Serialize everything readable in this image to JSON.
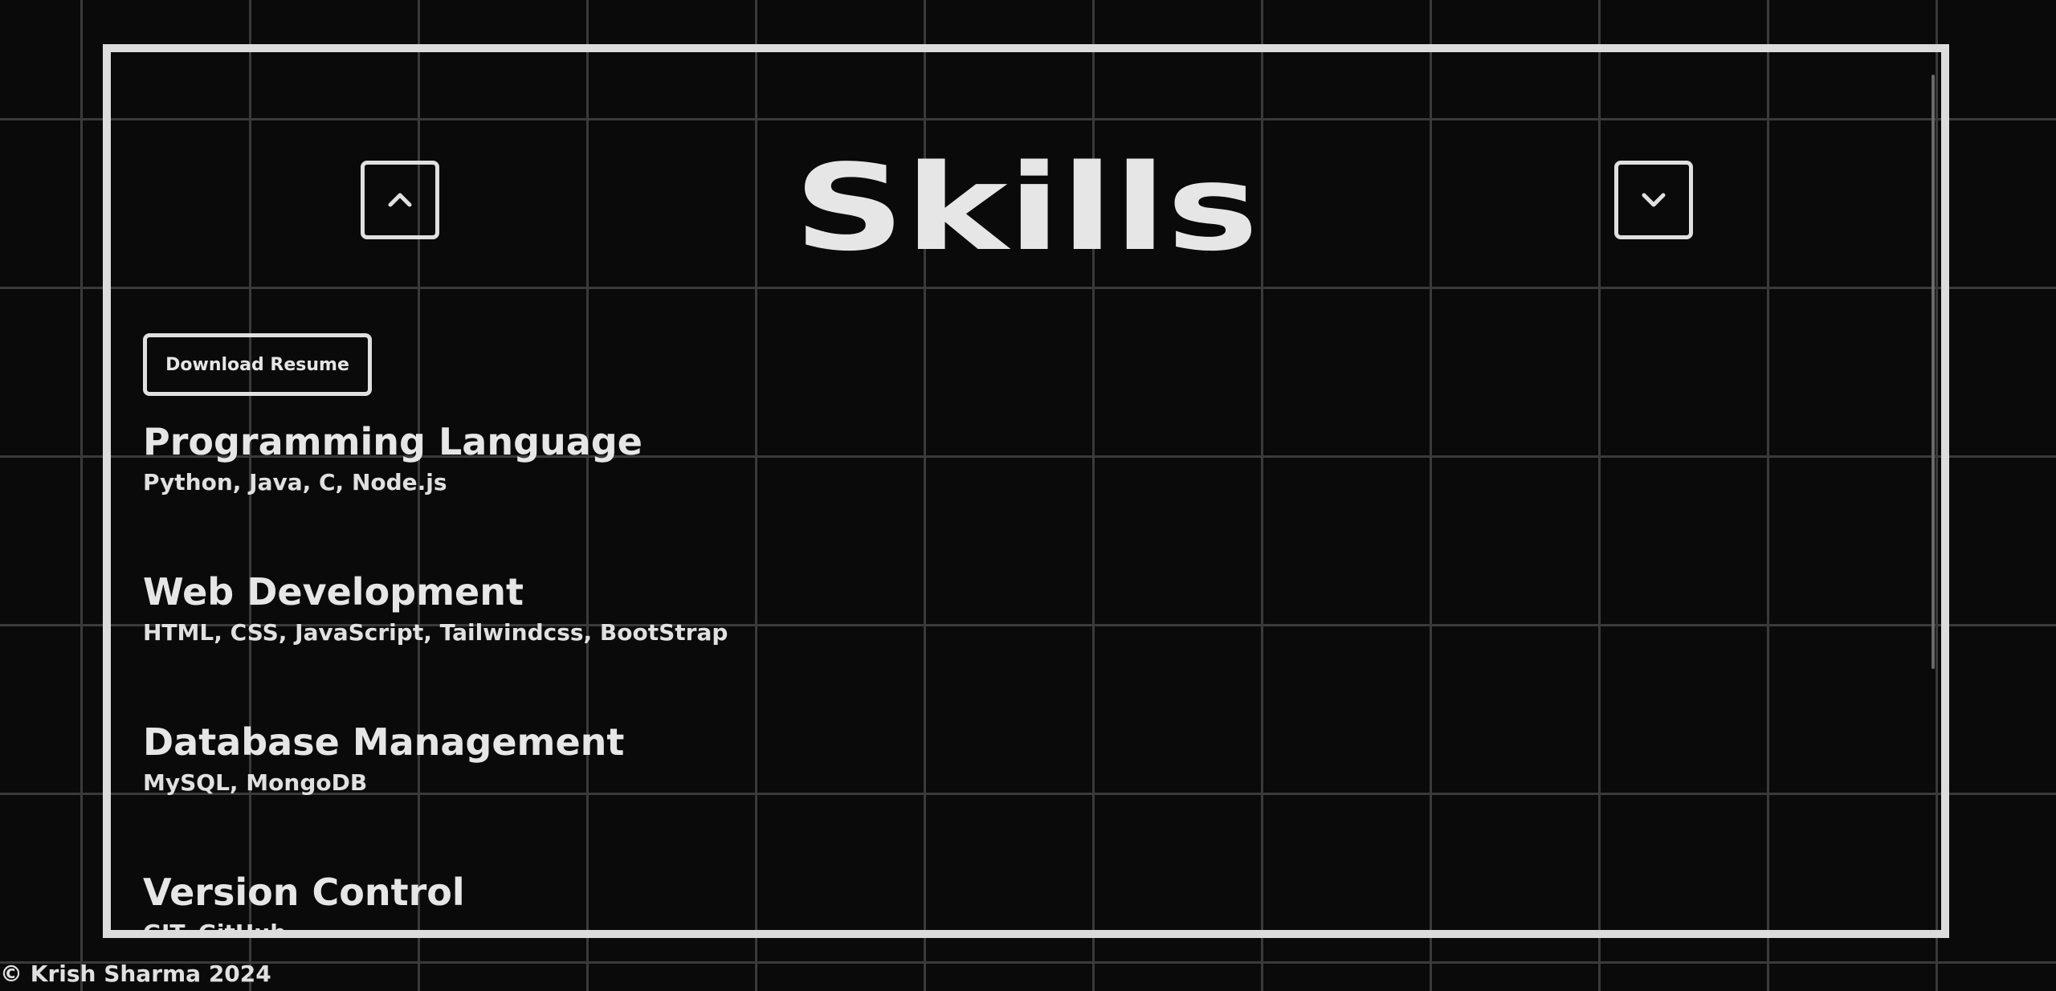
{
  "section": {
    "title": "Skills"
  },
  "nav": {
    "up_icon": "chevron-up-icon",
    "down_icon": "chevron-down-icon"
  },
  "download_button": {
    "label": "Download Resume"
  },
  "skills": [
    {
      "category": "Programming Language",
      "items": "Python, Java, C, Node.js"
    },
    {
      "category": "Web Development",
      "items": "HTML, CSS, JavaScript, Tailwindcss, BootStrap"
    },
    {
      "category": "Database Management",
      "items": "MySQL, MongoDB"
    },
    {
      "category": "Version Control",
      "items": "GIT, GitHub"
    }
  ],
  "footer": {
    "text": "© Krish Sharma 2024"
  },
  "colors": {
    "background": "#0a0a0a",
    "grid": "#3a3a3a",
    "foreground": "#e0e0e0"
  }
}
